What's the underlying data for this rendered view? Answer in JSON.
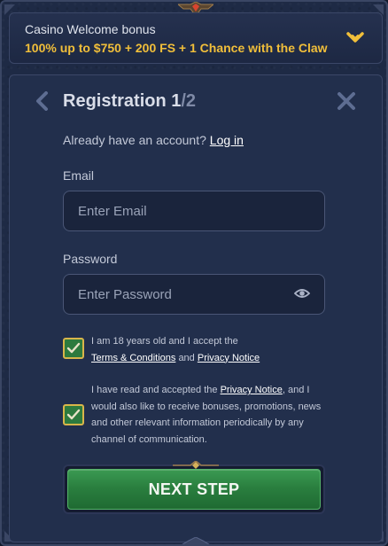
{
  "bonus": {
    "title": "Casino Welcome bonus",
    "offer": "100% up to $750 + 200 FS + 1 Chance with the Claw",
    "chevron_icon": "chevron-down-icon"
  },
  "registration": {
    "title": "Registration",
    "step_current": "1",
    "step_total": "/2",
    "back_icon": "chevron-left-icon",
    "close_icon": "close-icon"
  },
  "account": {
    "prompt": "Already have an account?",
    "login_link": "Log in"
  },
  "form": {
    "email_label": "Email",
    "email_placeholder": "Enter Email",
    "email_value": "",
    "password_label": "Password",
    "password_placeholder": "Enter Password",
    "password_value": "",
    "password_toggle_icon": "eye-icon"
  },
  "consents": {
    "age": {
      "checked": true,
      "text_start": "I am 18 years old and I accept the",
      "terms_link": "Terms & Conditions",
      "and": "and",
      "privacy_link": "Privacy Notice"
    },
    "marketing": {
      "checked": true,
      "text_start": "I have read and accepted the",
      "privacy_link": "Privacy Notice",
      "text_end": ", and I would also like to receive bonuses, promotions, news and other relevant information periodically by any channel of communication."
    }
  },
  "actions": {
    "next_label": "NEXT STEP"
  },
  "colors": {
    "background": "#1e2a45",
    "panel": "#222f4c",
    "accent_gold": "#f1bf3a",
    "button_green": "#2a7f3f",
    "checkbox_green": "#2d7a3e",
    "checkbox_border": "#d8b54a"
  }
}
